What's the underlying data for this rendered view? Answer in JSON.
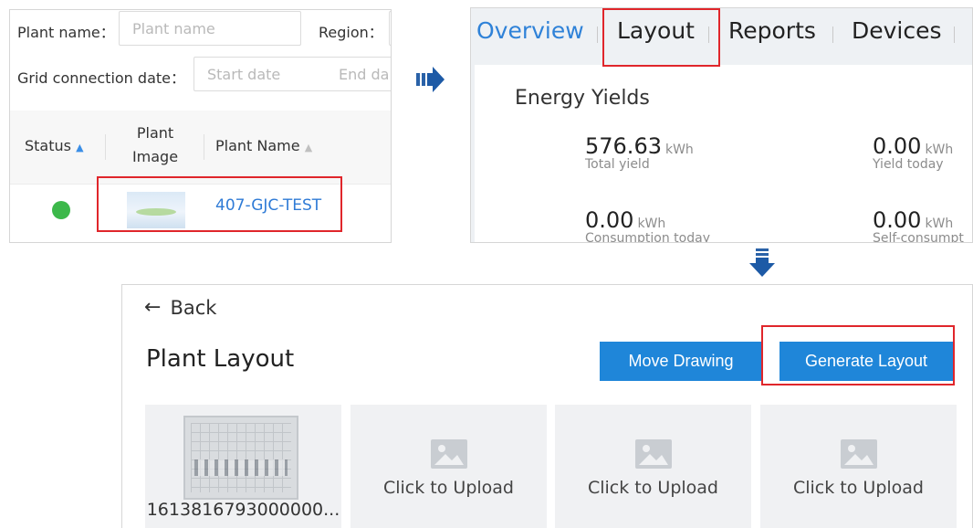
{
  "list_panel": {
    "plant_name_label": "Plant name：",
    "plant_name_placeholder": "Plant name",
    "region_label": "Region：",
    "grid_date_label": "Grid connection date：",
    "start_date_placeholder": "Start date",
    "end_date_placeholder": "End da",
    "columns": {
      "status": "Status",
      "image_line1": "Plant",
      "image_line2": "Image",
      "name": "Plant Name"
    },
    "row": {
      "status_color": "#3cb84a",
      "plant_name": "407-GJC-TEST"
    }
  },
  "overview_panel": {
    "tabs": [
      "Overview",
      "Layout",
      "Reports",
      "Devices"
    ],
    "active_tab": "Overview",
    "highlighted_tab": "Layout",
    "section_title": "Energy Yields",
    "metrics": [
      {
        "value": "576.63",
        "unit": "kWh",
        "caption": "Total yield"
      },
      {
        "value": "0.00",
        "unit": "kWh",
        "caption": "Yield today"
      },
      {
        "value": "0.00",
        "unit": "kWh",
        "caption": "Consumption today"
      },
      {
        "value": "0.00",
        "unit": "kWh",
        "caption": "Self-consumpt"
      }
    ]
  },
  "layout_panel": {
    "back_label": "Back",
    "title": "Plant Layout",
    "move_drawing_label": "Move Drawing",
    "generate_layout_label": "Generate Layout",
    "first_file_name": "1613816793000000...",
    "upload_label": "Click to Upload"
  },
  "colors": {
    "accent": "#1f86d9",
    "tab_active": "#2f82d8",
    "link": "#2f7bd6",
    "highlight": "#e0262b",
    "status_ok": "#3cb84a"
  },
  "icons": [
    "sort-icon",
    "arrow-right-icon",
    "arrow-down-icon",
    "back-arrow-icon",
    "image-placeholder-icon"
  ]
}
